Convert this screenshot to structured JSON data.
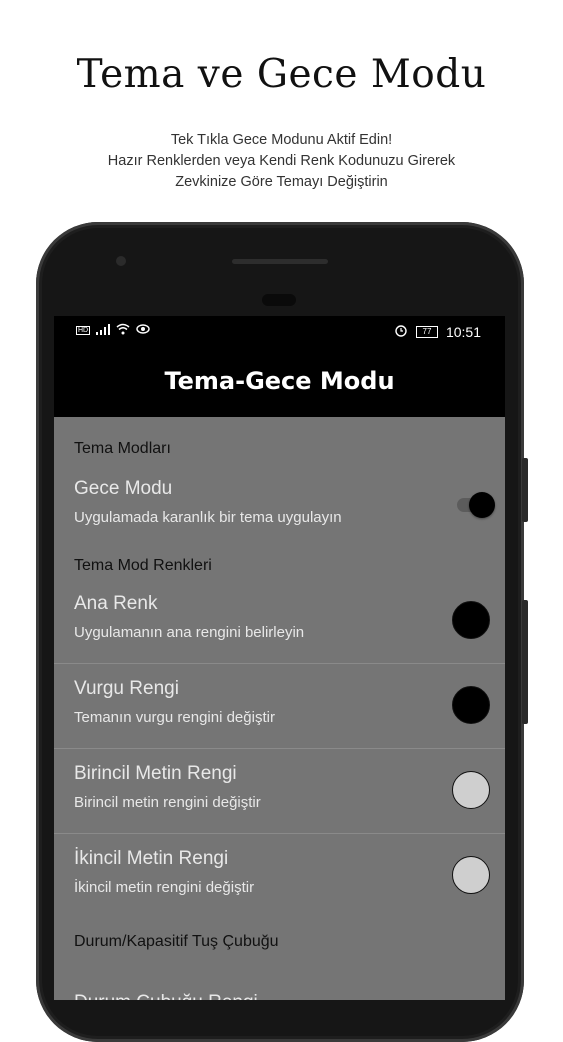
{
  "promo": {
    "title": "Tema ve Gece Modu",
    "subtitle_lines": [
      "Tek Tıkla Gece Modunu Aktif Edin!",
      "Hazır Renklerden veya Kendi Renk Kodunuzu Girerek",
      "Zevkinize Göre Temayı Değiştirin"
    ]
  },
  "statusbar": {
    "left_icons": [
      "hd-icon",
      "signal-icon",
      "wifi-icon",
      "eye-icon"
    ],
    "alarm_icon": "alarm-icon",
    "battery": "77",
    "time": "10:51"
  },
  "appbar": {
    "title": "Tema-Gece Modu"
  },
  "sections": [
    {
      "header": "Tema Modları",
      "items": [
        {
          "title": "Gece Modu",
          "summary": "Uygulamada karanlık bir tema uygulayın",
          "widget": "switch",
          "checked": true
        }
      ]
    },
    {
      "header": "Tema Mod Renkleri",
      "items": [
        {
          "title": "Ana Renk",
          "summary": "Uygulamanın ana rengini belirleyin",
          "widget": "color",
          "color": "#000000"
        },
        {
          "title": "Vurgu Rengi",
          "summary": "Temanın vurgu rengini değiştir",
          "widget": "color",
          "color": "#000000"
        },
        {
          "title": "Birincil Metin Rengi",
          "summary": "Birincil metin rengini değiştir",
          "widget": "color",
          "color": "#cfcfcf"
        },
        {
          "title": "İkincil Metin Rengi",
          "summary": "İkincil metin rengini değiştir",
          "widget": "color",
          "color": "#cfcfcf"
        }
      ]
    },
    {
      "header": "Durum/Kapasitif Tuş Çubuğu",
      "items": [
        {
          "title": "Durum Çubuğu Rengi",
          "partial": true
        }
      ]
    }
  ],
  "colors": {
    "screen_bg": "#757575",
    "appbar_bg": "#000000",
    "text_light": "#e8e8e8"
  }
}
